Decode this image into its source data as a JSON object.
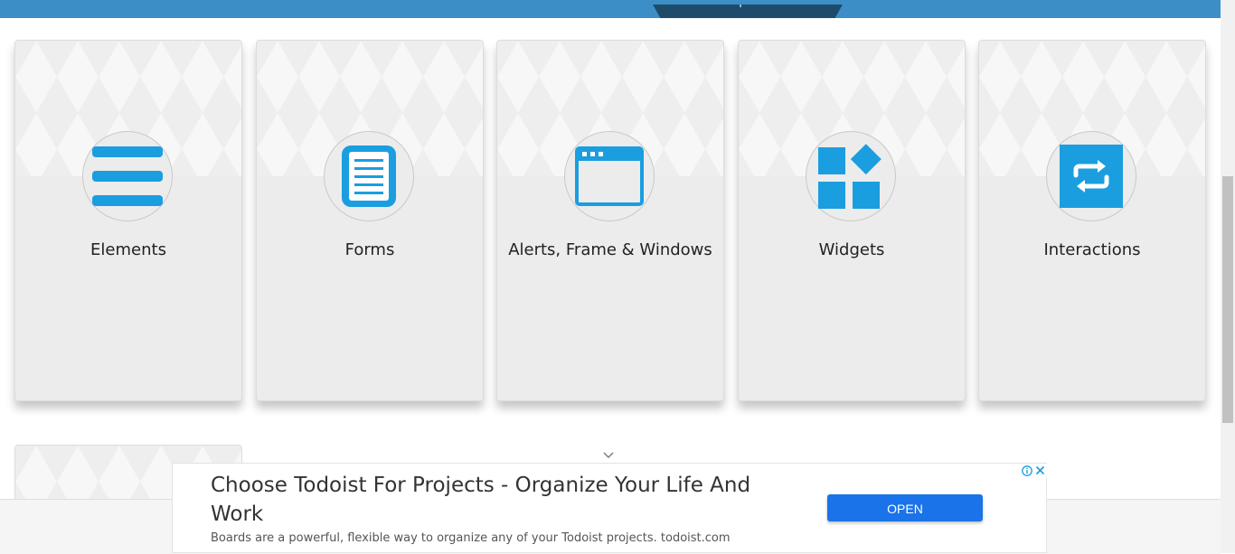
{
  "cards": [
    {
      "title": "Elements",
      "icon": "menu-lines-icon"
    },
    {
      "title": "Forms",
      "icon": "document-icon"
    },
    {
      "title": "Alerts, Frame & Windows",
      "icon": "browser-window-icon"
    },
    {
      "title": "Widgets",
      "icon": "widgets-blocks-icon"
    },
    {
      "title": "Interactions",
      "icon": "swap-arrows-icon"
    }
  ],
  "ad": {
    "headline": "Choose Todoist For Projects - Organize Your Life And Work",
    "description": "Boards are a powerful, flexible way to organize any of your Todoist projects. todoist.com",
    "button_label": "OPEN"
  },
  "colors": {
    "accent": "#1a9ee0",
    "top_bar": "#3b8fc6",
    "top_tab": "#1f4b6b",
    "ad_button": "#1a73e8"
  }
}
